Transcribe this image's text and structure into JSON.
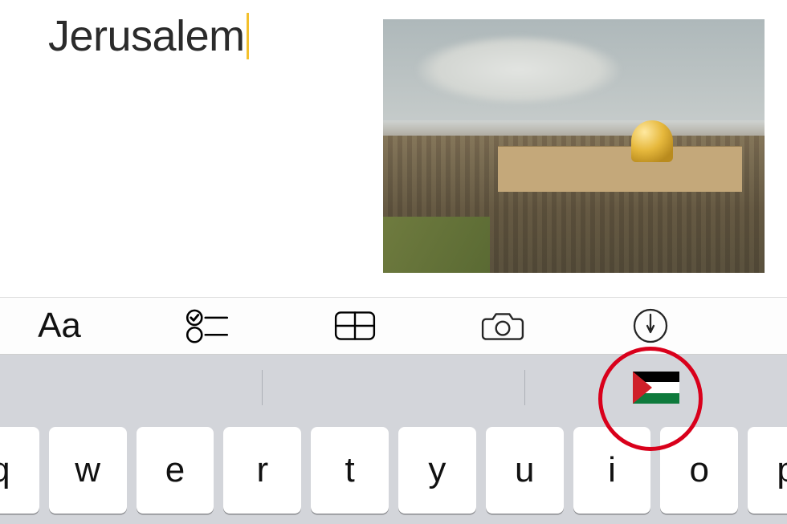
{
  "editor": {
    "typed_text": "Jerusalem"
  },
  "toolbar": {
    "format_label": "Aa",
    "buttons": {
      "format": "format-text",
      "checklist": "checklist",
      "table": "insert-table",
      "camera": "camera",
      "markup": "markup-pen"
    }
  },
  "suggestions": {
    "left": "",
    "middle": "",
    "right_emoji": "🇵🇸",
    "right_emoji_name": "flag-palestine"
  },
  "keyboard": {
    "row1": [
      "q",
      "w",
      "e",
      "r",
      "t",
      "y",
      "u",
      "i",
      "o",
      "p"
    ]
  },
  "annotation": {
    "circle_color": "#d9001b"
  },
  "inset_image": {
    "subject": "Jerusalem skyline with Dome of the Rock"
  }
}
